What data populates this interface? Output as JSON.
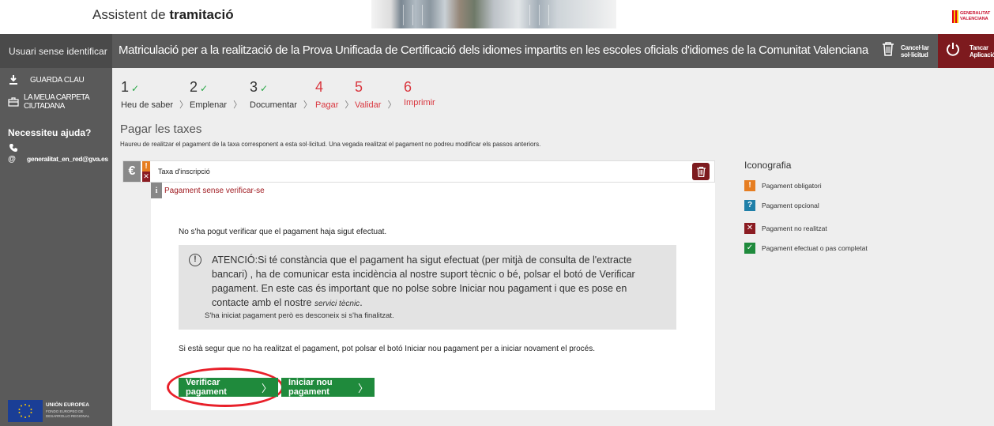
{
  "header": {
    "app_title_prefix": "Assistent de ",
    "app_title_bold": "tramitació",
    "logo_line1": "GENERALITAT",
    "logo_line2": "VALENCIANA"
  },
  "sidebar": {
    "user": "Usuari sense identificar",
    "items": [
      {
        "label": "GUARDA CLAU",
        "icon": "download-icon"
      },
      {
        "label": "LA MEUA CARPETA CIUTADANA",
        "icon": "folder-icon"
      }
    ],
    "help_title": "Necessiteu ajuda?",
    "contact_email": "generalitat_en_red@gva.es",
    "eu_title": "UNIÓN EUROPEA",
    "eu_subtitle_1": "FONDO EUROPEO DE",
    "eu_subtitle_2": "DESARROLLO REGIONAL"
  },
  "titlebar": {
    "title": "Matriculació per a la realització de la Prova Unificada de Certificació dels idiomes impartits en les escoles oficials d'idiomes de la Comunitat Valenciana",
    "cancel_line1": "Cancel·lar",
    "cancel_line2": "sol·licitud",
    "close_line1": "Tancar",
    "close_line2": "Aplicació"
  },
  "steps": [
    {
      "number": "1",
      "label": "Heu de saber",
      "done": true
    },
    {
      "number": "2",
      "label": "Emplenar",
      "done": true
    },
    {
      "number": "3",
      "label": "Documentar",
      "done": true
    },
    {
      "number": "4",
      "label": "Pagar",
      "done": false
    },
    {
      "number": "5",
      "label": "Validar",
      "done": false
    },
    {
      "number": "6",
      "label": "Imprimir",
      "done": false
    }
  ],
  "section": {
    "title": "Pagar les taxes",
    "description": "Haureu de realitzar el pagament de la taxa corresponent a esta sol·licitud. Una vegada realitzat el pagament no podreu modificar els passos anteriors."
  },
  "fee": {
    "currency_symbol": "€",
    "name": "Taxa d'inscripció",
    "status": "Pagament sense verificar-se",
    "not_verified_msg": "No s'ha pogut verificar que el pagament haja sigut efectuat.",
    "warning_main": "ATENCIÓ:Si té constància que el pagament ha sigut efectuat (per mitjà de consulta de l'extracte bancari) , ha de comunicar esta incidència al nostre suport tècnic o bé, polsar el botó de Verificar pagament. En este cas és important que no polse sobre Iniciar nou pagament i que es pose en contacte amb el nostre ",
    "warning_link": "servici tècnic",
    "warning_end": ".",
    "warning_footer": "S'ha iniciat pagament però es desconeix si s'ha finalitzat.",
    "retry_msg": "Si està segur que no ha realitzat el pagament, pot polsar el botó Iniciar nou pagament per a iniciar novament el procés.",
    "verify_button": "Verificar pagament",
    "new_payment_button": "Iniciar nou pagament"
  },
  "legend": {
    "title": "Iconografia",
    "items": [
      {
        "symbol": "!",
        "label": "Pagament obligatori",
        "color": "#e67e22"
      },
      {
        "symbol": "?",
        "label": "Pagament opcional",
        "color": "#1f7fa8"
      },
      {
        "symbol": "✕",
        "label": "Pagament no realitzat",
        "color": "#8b1c22"
      },
      {
        "symbol": "✓",
        "label": "Pagament efectuat o pas completat",
        "color": "#1f8a3c"
      }
    ]
  },
  "colors": {
    "sidebar": "#5a5a5a",
    "close_button": "#7d1a1e",
    "primary_button": "#1f8a3c",
    "pending_step": "#d9363e"
  }
}
